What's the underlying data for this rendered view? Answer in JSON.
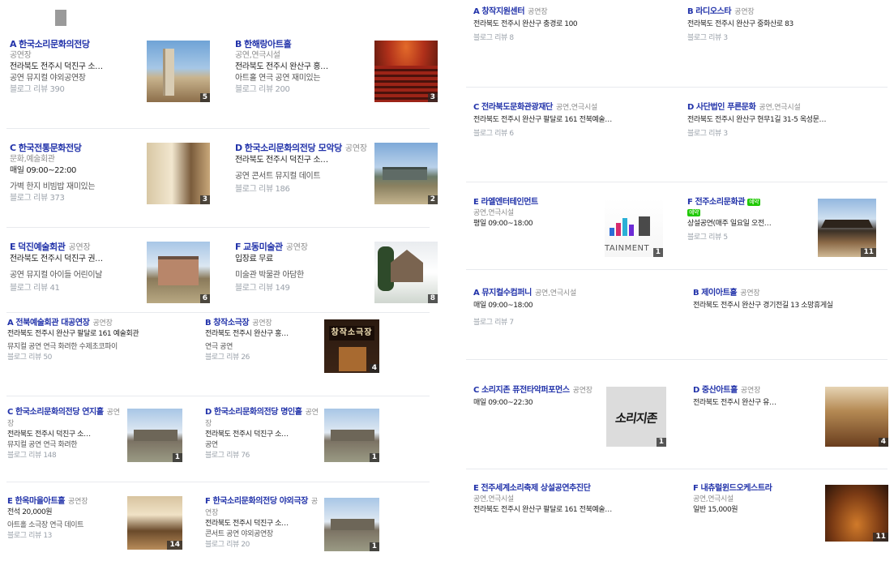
{
  "left": {
    "rows": [
      [
        {
          "letter": "A",
          "name": "한국소리문화의전당",
          "category": "",
          "lines": [
            {
              "k": "cat",
              "t": "공연장"
            },
            {
              "k": "addr",
              "t": "전라북도 전주시 덕진구 소…"
            },
            {
              "k": "tags",
              "t": "공연 뮤지컬 야외공연장"
            },
            {
              "k": "rev",
              "t": "블로그 리뷰 390"
            }
          ],
          "photo_count": "5"
        },
        {
          "letter": "B",
          "name": "한해랑아트홀",
          "category": "",
          "lines": [
            {
              "k": "cat",
              "t": "공연,연극시설"
            },
            {
              "k": "addr",
              "t": "전라북도 전주시 완산구 홍…"
            },
            {
              "k": "tags",
              "t": "아트홀 연극 공연 재미있는"
            },
            {
              "k": "rev",
              "t": "블로그 리뷰 200"
            }
          ],
          "photo_count": "3"
        }
      ],
      [
        {
          "letter": "C",
          "name": "한국전통문화전당",
          "category": "",
          "lines": [
            {
              "k": "cat",
              "t": "문화,예술회관"
            },
            {
              "k": "hours",
              "t": "매일 09:00~22:00"
            },
            {
              "k": "tags",
              "t": "가벽 한지 비빔밥 재미있는"
            },
            {
              "k": "rev",
              "t": "블로그 리뷰 373"
            }
          ],
          "photo_count": "3"
        },
        {
          "letter": "D",
          "name": "한국소리문화의전당 모악당",
          "category": "공연장",
          "lines": [
            {
              "k": "addr",
              "t": "전라북도 전주시 덕진구 소…"
            },
            {
              "k": "tags",
              "t": "공연 콘서트 뮤지컬 데이트"
            },
            {
              "k": "rev",
              "t": "블로그 리뷰 186"
            }
          ],
          "photo_count": "2"
        }
      ],
      [
        {
          "letter": "E",
          "name": "덕진예술회관",
          "category": "공연장",
          "lines": [
            {
              "k": "addr",
              "t": "전라북도 전주시 덕진구 권…"
            },
            {
              "k": "tags",
              "t": "공연 뮤지컬 아이들 어린이날"
            },
            {
              "k": "rev",
              "t": "블로그 리뷰 41"
            }
          ],
          "photo_count": "6"
        },
        {
          "letter": "F",
          "name": "교동미술관",
          "category": "공연장",
          "lines": [
            {
              "k": "price",
              "t": "입장료 무료"
            },
            {
              "k": "tags",
              "t": "미술관 박물관 아담한"
            },
            {
              "k": "rev",
              "t": "블로그 리뷰 149"
            }
          ],
          "photo_count": "8"
        }
      ],
      [
        {
          "letter": "A",
          "name": "전북예술회관 대공연장",
          "category": "공연장",
          "lines": [
            {
              "k": "addr",
              "t": "전라북도 전주시 완산구 팔달로 161 예술회관"
            },
            {
              "k": "tags",
              "t": "뮤지컬 공연 연극 화려한 수제초코파이"
            },
            {
              "k": "rev",
              "t": "블로그 리뷰 50"
            }
          ],
          "photo_count": ""
        },
        {
          "letter": "B",
          "name": "창작소극장",
          "category": "공연장",
          "lines": [
            {
              "k": "addr",
              "t": "전라북도 전주시 완산구 홍…"
            },
            {
              "k": "tags",
              "t": "연극 공연"
            },
            {
              "k": "rev",
              "t": "블로그 리뷰 26"
            }
          ],
          "photo_count": "4",
          "sign": "창작소극장"
        }
      ],
      [
        {
          "letter": "C",
          "name": "한국소리문화의전당 연지홀",
          "category": "공연장",
          "lines": [
            {
              "k": "addr",
              "t": "전라북도 전주시 덕진구 소…"
            },
            {
              "k": "tags",
              "t": "뮤지컬 공연 연극 화려한"
            },
            {
              "k": "rev",
              "t": "블로그 리뷰 148"
            }
          ],
          "photo_count": "1"
        },
        {
          "letter": "D",
          "name": "한국소리문화의전당 명인홀",
          "category": "공연장",
          "lines": [
            {
              "k": "addr",
              "t": "전라북도 전주시 덕진구 소…"
            },
            {
              "k": "tags",
              "t": "공연"
            },
            {
              "k": "rev",
              "t": "블로그 리뷰 76"
            }
          ],
          "photo_count": "1"
        }
      ],
      [
        {
          "letter": "E",
          "name": "한옥마을아트홀",
          "category": "공연장",
          "lines": [
            {
              "k": "price",
              "t": "전석 20,000원"
            },
            {
              "k": "tags",
              "t": "아트홀 소극장 연극 데이트"
            },
            {
              "k": "rev",
              "t": "블로그 리뷰 13"
            }
          ],
          "photo_count": "14"
        },
        {
          "letter": "F",
          "name": "한국소리문화의전당 야외극장",
          "category": "공연장",
          "lines": [
            {
              "k": "addr",
              "t": "전라북도 전주시 덕진구 소…"
            },
            {
              "k": "tags",
              "t": "콘서트 공연 야외공연장"
            },
            {
              "k": "rev",
              "t": "블로그 리뷰 20"
            }
          ],
          "photo_count": "1"
        }
      ]
    ]
  },
  "right": {
    "rows": [
      [
        {
          "letter": "A",
          "name": "창작지원센터",
          "category": "공연장",
          "lines": [
            {
              "k": "addr",
              "t": "전라북도 전주시 완산구 충경로 100"
            },
            {
              "k": "rev",
              "t": "블로그 리뷰 8"
            }
          ],
          "photo_count": ""
        },
        {
          "letter": "B",
          "name": "라디오스타",
          "category": "공연장",
          "lines": [
            {
              "k": "addr",
              "t": "전라북도 전주시 완산구 중화산로 83"
            },
            {
              "k": "rev",
              "t": "블로그 리뷰 3"
            }
          ],
          "photo_count": ""
        }
      ],
      [
        {
          "letter": "C",
          "name": "전라북도문화관광재단",
          "category": "공연,연극시설",
          "lines": [
            {
              "k": "addr",
              "t": "전라북도 전주시 완산구 팔달로 161 전북예술…"
            },
            {
              "k": "rev",
              "t": "블로그 리뷰 6"
            }
          ],
          "photo_count": ""
        },
        {
          "letter": "D",
          "name": "사단법인 푸른문화",
          "category": "공연,연극시설",
          "lines": [
            {
              "k": "addr",
              "t": "전라북도 전주시 완산구 현무1길 31-5 옥성문…"
            },
            {
              "k": "rev",
              "t": "블로그 리뷰 3"
            }
          ],
          "photo_count": ""
        }
      ],
      [
        {
          "letter": "E",
          "name": "라엘엔터테인먼트",
          "category": "",
          "lines": [
            {
              "k": "cat",
              "t": "공연,연극시설"
            },
            {
              "k": "hours",
              "t": "평일 09:00~18:00"
            }
          ],
          "photo_count": "1",
          "logo_text": "TAINMENT"
        },
        {
          "letter": "F",
          "name": "전주소리문화관",
          "category": "",
          "badge": "예약",
          "lines": [
            {
              "k": "badge",
              "t": "예약"
            },
            {
              "k": "addr",
              "t": "상설공연(매주 일요일 오전…"
            },
            {
              "k": "rev",
              "t": "블로그 리뷰 5"
            }
          ],
          "photo_count": "11"
        }
      ],
      [
        {
          "letter": "A",
          "name": "뮤지컬수컴퍼니",
          "category": "공연,연극시설",
          "lines": [
            {
              "k": "hours",
              "t": "매일 09:00~18:00"
            },
            {
              "k": "rev",
              "t": "블로그 리뷰 7"
            }
          ],
          "photo_count": ""
        },
        {
          "letter": "B",
          "name": "제이아트홀",
          "category": "공연장",
          "lines": [
            {
              "k": "addr",
              "t": "전라북도 전주시 완산구 경기전길 13 소망휴게실"
            }
          ],
          "photo_count": ""
        }
      ],
      [
        {
          "letter": "C",
          "name": "소리지존 퓨전타악퍼포먼스",
          "category": "공연장",
          "lines": [
            {
              "k": "hours",
              "t": "매일 09:00~22:30"
            }
          ],
          "photo_count": "1",
          "logo_text": "소리지존"
        },
        {
          "letter": "D",
          "name": "중산아트홀",
          "category": "공연장",
          "lines": [
            {
              "k": "addr",
              "t": "전라북도 전주시 완산구 유…"
            }
          ],
          "photo_count": "4"
        }
      ],
      [
        {
          "letter": "E",
          "name": "전주세계소리축제 상설공연추진단",
          "category": "",
          "lines": [
            {
              "k": "cat",
              "t": "공연,연극시설"
            },
            {
              "k": "addr",
              "t": "전라북도 전주시 완산구 팔달로 161 전북예술…"
            }
          ],
          "photo_count": ""
        },
        {
          "letter": "F",
          "name": "내츄럴윈드오케스트라",
          "category": "",
          "lines": [
            {
              "k": "cat",
              "t": "공연,연극시설"
            },
            {
              "k": "price",
              "t": "일반 15,000원"
            }
          ],
          "photo_count": "11"
        }
      ]
    ]
  }
}
